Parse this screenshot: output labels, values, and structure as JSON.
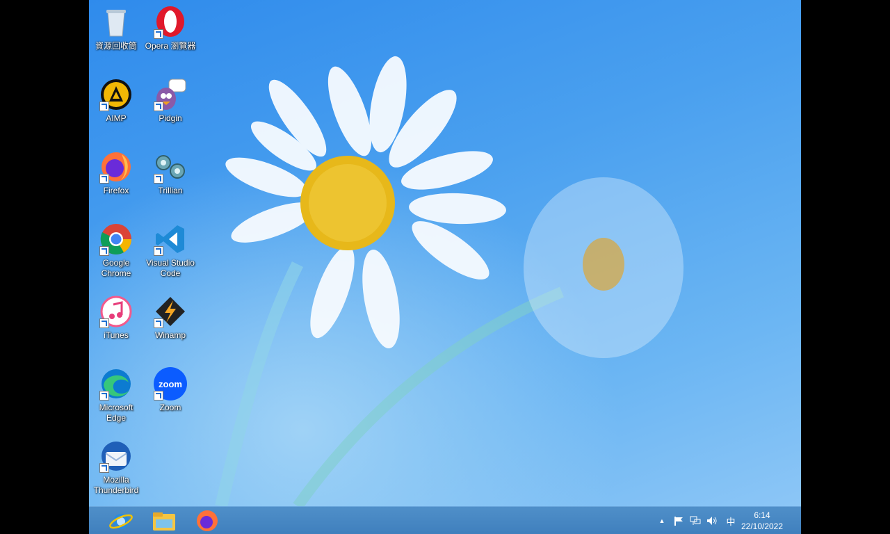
{
  "desktop": {
    "icons": [
      {
        "label": "資源回收筒",
        "icon": "recycle-bin-icon"
      },
      {
        "label": "Opera 瀏覽器",
        "icon": "opera-icon"
      },
      {
        "label": "AIMP",
        "icon": "aimp-icon"
      },
      {
        "label": "Pidgin",
        "icon": "pidgin-icon"
      },
      {
        "label": "Firefox",
        "icon": "firefox-icon"
      },
      {
        "label": "Trillian",
        "icon": "trillian-icon"
      },
      {
        "label": "Google Chrome",
        "icon": "chrome-icon"
      },
      {
        "label": "Visual Studio Code",
        "icon": "vscode-icon"
      },
      {
        "label": "iTunes",
        "icon": "itunes-icon"
      },
      {
        "label": "Winamp",
        "icon": "winamp-icon"
      },
      {
        "label": "Microsoft Edge",
        "icon": "edge-icon"
      },
      {
        "label": "Zoom",
        "icon": "zoom-icon"
      },
      {
        "label": "Mozilla Thunderbird",
        "icon": "thunderbird-icon"
      }
    ],
    "zoom_logo_text": "zoom"
  },
  "taskbar": {
    "pinned": [
      "internet-explorer-icon",
      "file-explorer-icon",
      "firefox-icon"
    ],
    "tray": {
      "show_hidden": "▲",
      "ime": "中"
    },
    "clock": {
      "time": "6:14",
      "date": "22/10/2022"
    }
  }
}
